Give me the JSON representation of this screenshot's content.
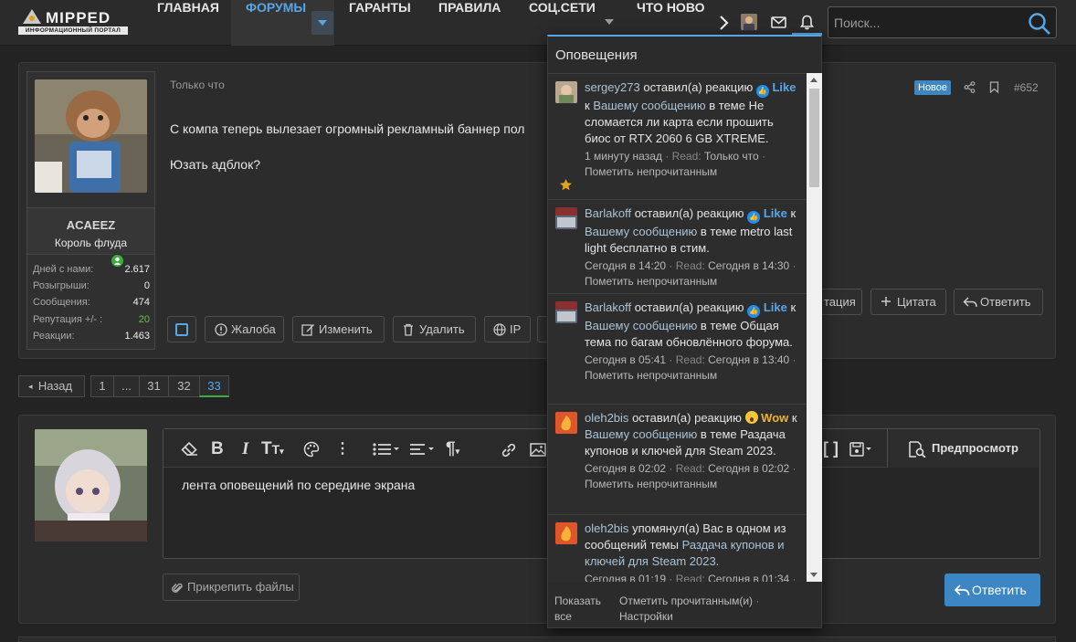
{
  "header": {
    "logo_main": "MIPPED",
    "logo_sub": "ИНФОРМАЦИОННЫЙ ПОРТАЛ",
    "nav": [
      "ГЛАВНАЯ",
      "ФОРУМЫ",
      "ГАРАНТЫ",
      "ПРАВИЛА",
      "СОЦ.СЕТИ",
      "ЧТО НОВО"
    ],
    "search_placeholder": "Поиск..."
  },
  "post": {
    "time": "Только что",
    "line1": "С компа теперь вылезает огромный рекламный баннер пол",
    "line2": "Юзать адблок?",
    "badge": "Новое",
    "number": "#652",
    "actions": {
      "report": "Жалоба",
      "edit": "Изменить",
      "delete": "Удалить",
      "ip": "IP",
      "quote_partial": "тация",
      "quote": "Цитата",
      "reply": "Ответить"
    }
  },
  "user": {
    "name": "ACAEEZ",
    "title": "Король флуда",
    "stats": [
      {
        "label": "Дней с нами:",
        "value": "2.617"
      },
      {
        "label": "Розыгрыши:",
        "value": "0"
      },
      {
        "label": "Сообщения:",
        "value": "474"
      },
      {
        "label": "Репутация +/- :",
        "value": "20"
      },
      {
        "label": "Реакции:",
        "value": "1.463"
      }
    ]
  },
  "pagination": {
    "back": "Назад",
    "pages": [
      "1",
      "...",
      "31",
      "32",
      "33"
    ],
    "current": "33"
  },
  "reply": {
    "editor_text": "лента оповещений по середине экрана",
    "preview": "Предпросмотр",
    "attach": "Прикрепить файлы",
    "submit": "Ответить"
  },
  "notifications": {
    "title": "Оповещения",
    "items": [
      {
        "user": "sergey273",
        "action": "оставил(а) реакцию",
        "reaction": "Like",
        "pre": "к",
        "mid": "Вашему сообщению",
        "post": "в теме",
        "topic": "Не сломается ли карта если прошить биос от RTX 2060 6 GB XTREME.",
        "time": "1 минуту назад",
        "read_label": "Read:",
        "read": "Только что",
        "mark": "Пометить непрочитанным"
      },
      {
        "user": "Barlakoff",
        "action": "оставил(а) реакцию",
        "reaction": "Like",
        "pre": "к",
        "mid": "Вашему сообщению",
        "post": "в теме",
        "topic": "metro last light бесплатно в стим.",
        "time": "Сегодня в 14:20",
        "read_label": "Read:",
        "read": "Сегодня в 14:30",
        "mark": "Пометить непрочитанным"
      },
      {
        "user": "Barlakoff",
        "action": "оставил(а) реакцию",
        "reaction": "Like",
        "pre": "к",
        "mid": "Вашему сообщению",
        "post": "в теме",
        "topic": "Общая тема по багам обновлённого форума.",
        "time": "Сегодня в 05:41",
        "read_label": "Read:",
        "read": "Сегодня в 13:40",
        "mark": "Пометить непрочитанным"
      },
      {
        "user": "oleh2bis",
        "action": "оставил(а) реакцию",
        "reaction": "Wow",
        "pre": "к",
        "mid": "Вашему сообщению",
        "post": "в теме",
        "topic": "Раздача купонов и ключей для Steam 2023.",
        "time": "Сегодня в 02:02",
        "read_label": "Read:",
        "read": "Сегодня в 02:02",
        "mark": "Пометить непрочитанным"
      },
      {
        "user": "oleh2bis",
        "action": "упомянул(а) Вас в одном из сообщений темы",
        "topic": "Раздача купонов и ключей для Steam 2023.",
        "time": "Сегодня в 01:19",
        "read_label": "Read:",
        "read": "Сегодня в 01:34"
      }
    ],
    "footer": {
      "show_all": "Показать все",
      "mark_read": "Отметить прочитанным(и)",
      "settings": "Настройки"
    }
  },
  "colors": {
    "accent": "#58a6e6",
    "like": "#1f8ef1",
    "online": "#3faa3f",
    "reputation": "#6bbf4e"
  }
}
